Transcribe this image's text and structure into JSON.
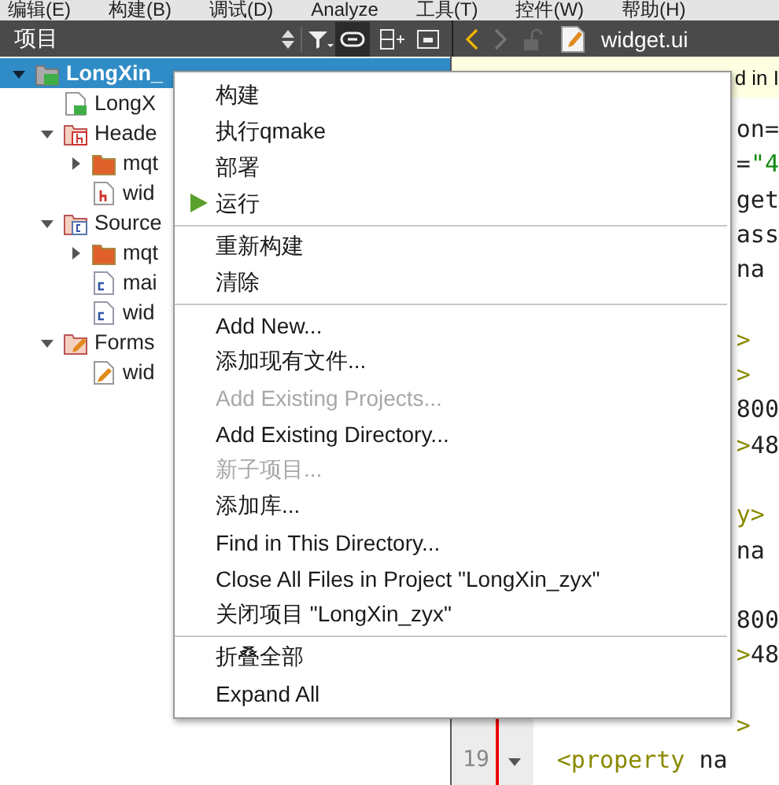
{
  "menu_bar": [
    "编辑(E)",
    "构建(B)",
    "调试(D)",
    "Analyze",
    "工具(T)",
    "控件(W)",
    "帮助(H)"
  ],
  "projects_panel": {
    "title": "项目",
    "link_with_editor": true,
    "tree": [
      {
        "label": "LongXin_",
        "kind": "project",
        "expanded": true,
        "selected": true,
        "children": [
          {
            "label": "LongX",
            "kind": "pro-file",
            "selected": false
          },
          {
            "label": "Heade",
            "kind": "header-folder",
            "expanded": true,
            "selected": false,
            "children": [
              {
                "label": "mqt",
                "kind": "folder",
                "expanded": false,
                "selected": false
              },
              {
                "label": "wid",
                "kind": "header-file",
                "selected": false
              }
            ]
          },
          {
            "label": "Source",
            "kind": "source-folder",
            "expanded": true,
            "selected": false,
            "children": [
              {
                "label": "mqt",
                "kind": "folder",
                "expanded": false,
                "selected": false
              },
              {
                "label": "mai",
                "kind": "source-file",
                "selected": false
              },
              {
                "label": "wid",
                "kind": "source-file",
                "selected": false
              }
            ]
          },
          {
            "label": "Forms",
            "kind": "form-folder",
            "expanded": true,
            "selected": false,
            "children": [
              {
                "label": "wid",
                "kind": "form-file",
                "selected": false
              }
            ]
          }
        ]
      }
    ]
  },
  "editor": {
    "back_enabled": true,
    "forward_enabled": false,
    "file_name": "widget.ui",
    "info_bar": "d in I",
    "lines": [
      {
        "kind": "covered",
        "segments": [
          {
            "text": "on=",
            "kind": "plain"
          }
        ]
      },
      {
        "kind": "covered",
        "segments": [
          {
            "text": "=",
            "kind": "plain"
          },
          {
            "text": "\"4",
            "kind": "string"
          }
        ]
      },
      {
        "kind": "covered",
        "segments": [
          {
            "text": "get",
            "kind": "plain"
          }
        ]
      },
      {
        "kind": "covered",
        "segments": [
          {
            "text": "ass",
            "kind": "plain"
          }
        ]
      },
      {
        "kind": "covered",
        "segments": [
          {
            "text": "na",
            "kind": "plain"
          }
        ]
      },
      {
        "kind": "blank"
      },
      {
        "kind": "covered",
        "segments": [
          {
            "text": ">",
            "kind": "tag"
          }
        ]
      },
      {
        "kind": "covered",
        "segments": [
          {
            "text": ">",
            "kind": "tag"
          }
        ]
      },
      {
        "kind": "covered",
        "segments": [
          {
            "text": "800",
            "kind": "plain"
          }
        ]
      },
      {
        "kind": "covered",
        "segments": [
          {
            "text": ">",
            "kind": "tag"
          },
          {
            "text": "48",
            "kind": "plain"
          }
        ]
      },
      {
        "kind": "blank"
      },
      {
        "kind": "covered",
        "segments": [
          {
            "text": "y>",
            "kind": "tag"
          }
        ]
      },
      {
        "kind": "covered",
        "segments": [
          {
            "text": "na",
            "kind": "plain"
          }
        ]
      },
      {
        "kind": "blank"
      },
      {
        "kind": "covered",
        "segments": [
          {
            "text": "800",
            "kind": "plain"
          }
        ]
      },
      {
        "kind": "covered",
        "segments": [
          {
            "text": ">",
            "kind": "tag"
          },
          {
            "text": "48",
            "kind": "plain"
          }
        ]
      },
      {
        "kind": "blank"
      },
      {
        "kind": "covered",
        "segments": [
          {
            "text": ">",
            "kind": "tag"
          }
        ]
      },
      {
        "kind": "full",
        "line_number": "19",
        "foldable": true,
        "segments": [
          {
            "text": "<property",
            "kind": "tag"
          },
          {
            "text": " na",
            "kind": "plain"
          }
        ]
      }
    ]
  },
  "context_menu": [
    {
      "kind": "item",
      "label": "构建",
      "disabled": false
    },
    {
      "kind": "item",
      "label": "执行qmake",
      "disabled": false
    },
    {
      "kind": "item",
      "label": "部署",
      "disabled": false
    },
    {
      "kind": "run-item",
      "label": "运行",
      "disabled": false
    },
    {
      "kind": "separator"
    },
    {
      "kind": "item",
      "label": "重新构建",
      "disabled": false
    },
    {
      "kind": "item",
      "label": "清除",
      "disabled": false
    },
    {
      "kind": "separator"
    },
    {
      "kind": "item",
      "label": "Add New...",
      "disabled": false
    },
    {
      "kind": "item",
      "label": "添加现有文件...",
      "disabled": false
    },
    {
      "kind": "item",
      "label": "Add Existing Projects...",
      "disabled": true
    },
    {
      "kind": "item",
      "label": "Add Existing Directory...",
      "disabled": false
    },
    {
      "kind": "item",
      "label": "新子项目...",
      "disabled": true
    },
    {
      "kind": "item",
      "label": "添加库...",
      "disabled": false
    },
    {
      "kind": "item",
      "label": "Find in This Directory...",
      "disabled": false
    },
    {
      "kind": "item",
      "label": "Close All Files in Project \"LongXin_zyx\"",
      "disabled": false
    },
    {
      "kind": "item",
      "label": "关闭项目 \"LongXin_zyx\"",
      "disabled": false
    },
    {
      "kind": "separator"
    },
    {
      "kind": "item",
      "label": "折叠全部",
      "disabled": false
    },
    {
      "kind": "item",
      "label": "Expand All",
      "disabled": false
    }
  ]
}
